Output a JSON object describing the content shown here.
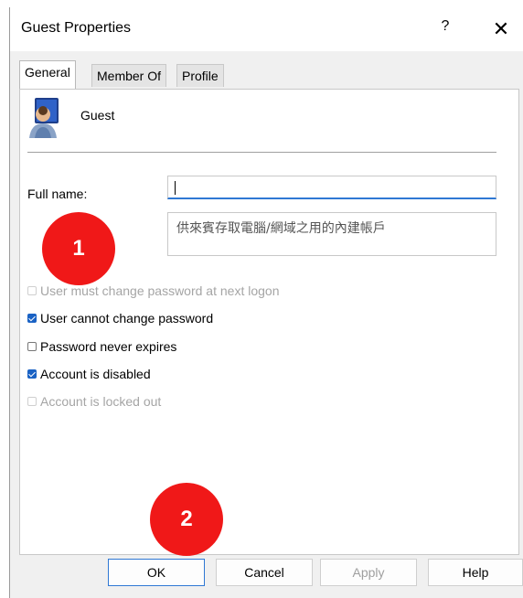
{
  "window": {
    "title": "Guest Properties",
    "help": "?",
    "close": "✕"
  },
  "tabs": [
    {
      "label": "General",
      "active": true
    },
    {
      "label": "Member Of",
      "active": false
    },
    {
      "label": "Profile",
      "active": false
    }
  ],
  "user": {
    "name": "Guest",
    "icon": "user-account-icon"
  },
  "fields": {
    "full_name_label": "Full name:",
    "full_name_value": "",
    "description_value": "供來賓存取電腦/網域之用的內建帳戶"
  },
  "checkboxes": [
    {
      "label": "User must change password at next logon",
      "checked": false,
      "enabled": false
    },
    {
      "label": "User cannot change password",
      "checked": true,
      "enabled": true
    },
    {
      "label": "Password never expires",
      "checked": false,
      "enabled": true
    },
    {
      "label": "Account is disabled",
      "checked": true,
      "enabled": true
    },
    {
      "label": "Account is locked out",
      "checked": false,
      "enabled": false
    }
  ],
  "buttons": {
    "ok": "OK",
    "cancel": "Cancel",
    "apply": "Apply",
    "help": "Help"
  },
  "annotations": {
    "step1": "1",
    "step2": "2"
  },
  "colors": {
    "accent": "#2f78d4",
    "checkbox": "#1a62c4",
    "badge": "#f01818"
  }
}
